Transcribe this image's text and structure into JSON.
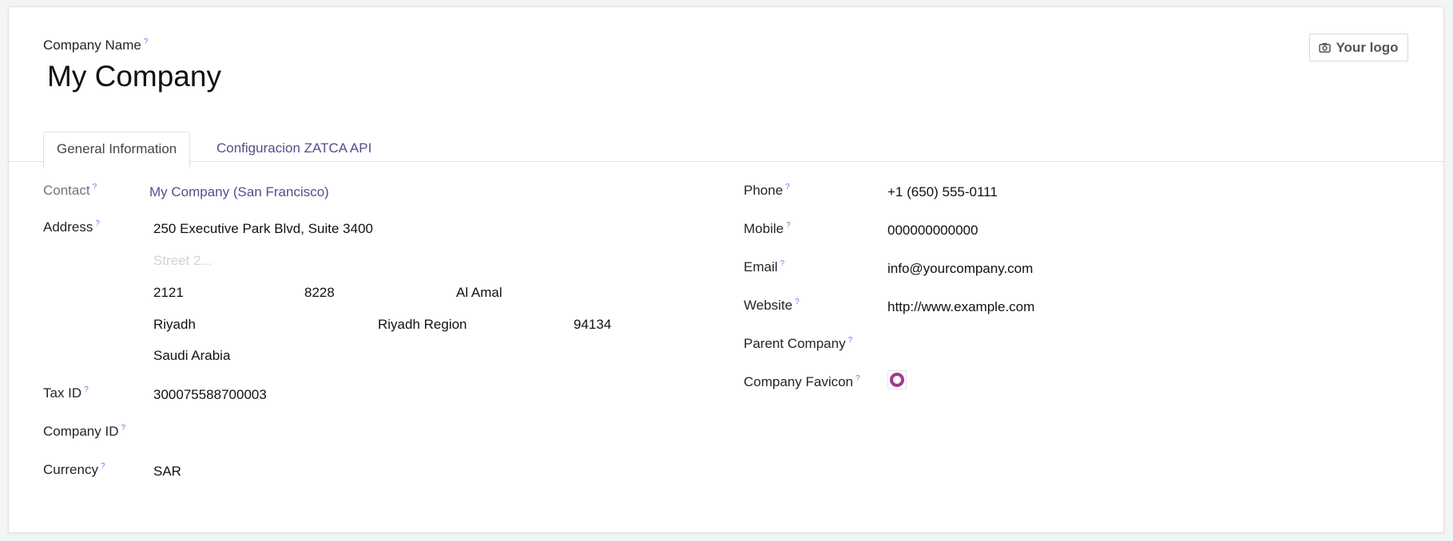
{
  "header": {
    "name_label": "Company Name",
    "name_value": "My Company",
    "help_mark": "?",
    "logo_button": "Your logo"
  },
  "tabs": [
    {
      "label": "General Information",
      "active": true
    },
    {
      "label": "Configuracion ZATCA API",
      "active": false
    }
  ],
  "left": {
    "contact_label": "Contact",
    "contact_value": "My Company (San Francisco)",
    "address_label": "Address",
    "street": "250 Executive Park Blvd, Suite 3400",
    "street2_placeholder": "Street 2...",
    "building_no": "2121",
    "additional_no": "8228",
    "district": "Al Amal",
    "city": "Riyadh",
    "state": "Riyadh Region",
    "zip": "94134",
    "country": "Saudi Arabia",
    "taxid_label": "Tax ID",
    "taxid_value": "300075588700003",
    "companyid_label": "Company ID",
    "companyid_value": "",
    "currency_label": "Currency",
    "currency_value": "SAR"
  },
  "right": {
    "phone_label": "Phone",
    "phone_value": "+1 (650) 555-0111",
    "mobile_label": "Mobile",
    "mobile_value": "000000000000",
    "email_label": "Email",
    "email_value": "info@yourcompany.com",
    "website_label": "Website",
    "website_value": "http://www.example.com",
    "parent_label": "Parent Company",
    "parent_value": "",
    "favicon_label": "Company Favicon"
  },
  "colors": {
    "accent": "#5b4a8b",
    "favicon_ring": "#a53a8a"
  }
}
